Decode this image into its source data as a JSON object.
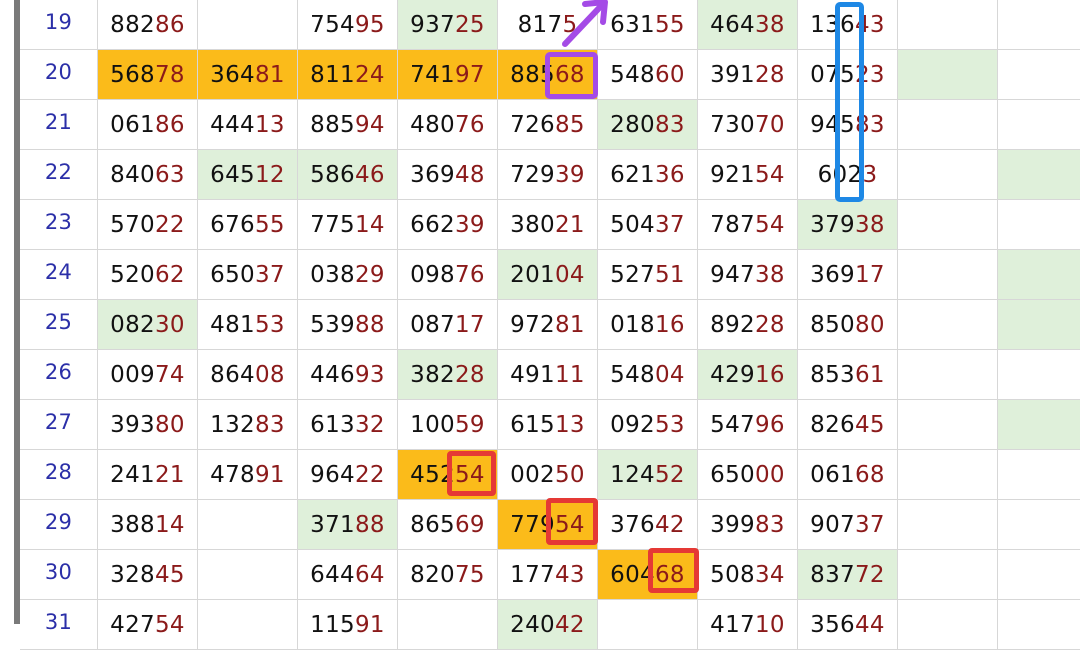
{
  "colors": {
    "green": "#dff0da",
    "orange": "#fbbb1a",
    "red_mark": "#e53935",
    "purple_mark": "#a44be6",
    "blue_mark": "#1e88e5",
    "index_text": "#2b2fa8",
    "tail_text": "#8b1a1a"
  },
  "rows": [
    {
      "idx": "19",
      "cells": [
        {
          "head": "882",
          "tail": "86",
          "bg": ""
        },
        {
          "head": "",
          "tail": "",
          "bg": ""
        },
        {
          "head": "754",
          "tail": "95",
          "bg": ""
        },
        {
          "head": "937",
          "tail": "25",
          "bg": "g"
        },
        {
          "head": "817",
          "tail": "5",
          "bg": ""
        },
        {
          "head": "631",
          "tail": "55",
          "bg": ""
        },
        {
          "head": "464",
          "tail": "38",
          "bg": "g"
        },
        {
          "head": "136",
          "tail": "43",
          "bg": ""
        },
        {
          "head": "",
          "tail": "",
          "bg": ""
        },
        {
          "head": "",
          "tail": "",
          "bg": ""
        }
      ]
    },
    {
      "idx": "20",
      "cells": [
        {
          "head": "568",
          "tail": "78",
          "bg": "o"
        },
        {
          "head": "364",
          "tail": "81",
          "bg": "o"
        },
        {
          "head": "811",
          "tail": "24",
          "bg": "o"
        },
        {
          "head": "741",
          "tail": "97",
          "bg": "o"
        },
        {
          "head": "885",
          "tail": "68",
          "bg": "o"
        },
        {
          "head": "548",
          "tail": "60",
          "bg": ""
        },
        {
          "head": "391",
          "tail": "28",
          "bg": ""
        },
        {
          "head": "075",
          "tail": "23",
          "bg": ""
        },
        {
          "head": "",
          "tail": "",
          "bg": "g"
        },
        {
          "head": "",
          "tail": "",
          "bg": ""
        }
      ]
    },
    {
      "idx": "21",
      "cells": [
        {
          "head": "061",
          "tail": "86",
          "bg": ""
        },
        {
          "head": "444",
          "tail": "13",
          "bg": ""
        },
        {
          "head": "885",
          "tail": "94",
          "bg": ""
        },
        {
          "head": "480",
          "tail": "76",
          "bg": ""
        },
        {
          "head": "726",
          "tail": "85",
          "bg": ""
        },
        {
          "head": "280",
          "tail": "83",
          "bg": "g"
        },
        {
          "head": "730",
          "tail": "70",
          "bg": ""
        },
        {
          "head": "945",
          "tail": "83",
          "bg": ""
        },
        {
          "head": "",
          "tail": "",
          "bg": ""
        },
        {
          "head": "",
          "tail": "",
          "bg": ""
        }
      ]
    },
    {
      "idx": "22",
      "cells": [
        {
          "head": "840",
          "tail": "63",
          "bg": ""
        },
        {
          "head": "645",
          "tail": "12",
          "bg": "g"
        },
        {
          "head": "586",
          "tail": "46",
          "bg": "g"
        },
        {
          "head": "369",
          "tail": "48",
          "bg": ""
        },
        {
          "head": "729",
          "tail": "39",
          "bg": ""
        },
        {
          "head": "621",
          "tail": "36",
          "bg": ""
        },
        {
          "head": "921",
          "tail": "54",
          "bg": ""
        },
        {
          "head": "602",
          "tail": "3",
          "bg": ""
        },
        {
          "head": "",
          "tail": "",
          "bg": ""
        },
        {
          "head": "",
          "tail": "",
          "bg": "g"
        }
      ]
    },
    {
      "idx": "23",
      "cells": [
        {
          "head": "570",
          "tail": "22",
          "bg": ""
        },
        {
          "head": "676",
          "tail": "55",
          "bg": ""
        },
        {
          "head": "775",
          "tail": "14",
          "bg": ""
        },
        {
          "head": "662",
          "tail": "39",
          "bg": ""
        },
        {
          "head": "380",
          "tail": "21",
          "bg": ""
        },
        {
          "head": "504",
          "tail": "37",
          "bg": ""
        },
        {
          "head": "787",
          "tail": "54",
          "bg": ""
        },
        {
          "head": "379",
          "tail": "38",
          "bg": "g"
        },
        {
          "head": "",
          "tail": "",
          "bg": ""
        },
        {
          "head": "",
          "tail": "",
          "bg": ""
        }
      ]
    },
    {
      "idx": "24",
      "cells": [
        {
          "head": "520",
          "tail": "62",
          "bg": ""
        },
        {
          "head": "650",
          "tail": "37",
          "bg": ""
        },
        {
          "head": "038",
          "tail": "29",
          "bg": ""
        },
        {
          "head": "098",
          "tail": "76",
          "bg": ""
        },
        {
          "head": "201",
          "tail": "04",
          "bg": "g"
        },
        {
          "head": "527",
          "tail": "51",
          "bg": ""
        },
        {
          "head": "947",
          "tail": "38",
          "bg": ""
        },
        {
          "head": "369",
          "tail": "17",
          "bg": ""
        },
        {
          "head": "",
          "tail": "",
          "bg": ""
        },
        {
          "head": "",
          "tail": "",
          "bg": "g"
        }
      ]
    },
    {
      "idx": "25",
      "cells": [
        {
          "head": "082",
          "tail": "30",
          "bg": "g"
        },
        {
          "head": "481",
          "tail": "53",
          "bg": ""
        },
        {
          "head": "539",
          "tail": "88",
          "bg": ""
        },
        {
          "head": "087",
          "tail": "17",
          "bg": ""
        },
        {
          "head": "972",
          "tail": "81",
          "bg": ""
        },
        {
          "head": "018",
          "tail": "16",
          "bg": ""
        },
        {
          "head": "892",
          "tail": "28",
          "bg": ""
        },
        {
          "head": "850",
          "tail": "80",
          "bg": ""
        },
        {
          "head": "",
          "tail": "",
          "bg": ""
        },
        {
          "head": "",
          "tail": "",
          "bg": "g"
        }
      ]
    },
    {
      "idx": "26",
      "cells": [
        {
          "head": "009",
          "tail": "74",
          "bg": ""
        },
        {
          "head": "864",
          "tail": "08",
          "bg": ""
        },
        {
          "head": "446",
          "tail": "93",
          "bg": ""
        },
        {
          "head": "382",
          "tail": "28",
          "bg": "g"
        },
        {
          "head": "491",
          "tail": "11",
          "bg": ""
        },
        {
          "head": "548",
          "tail": "04",
          "bg": ""
        },
        {
          "head": "429",
          "tail": "16",
          "bg": "g"
        },
        {
          "head": "853",
          "tail": "61",
          "bg": ""
        },
        {
          "head": "",
          "tail": "",
          "bg": ""
        },
        {
          "head": "",
          "tail": "",
          "bg": ""
        }
      ]
    },
    {
      "idx": "27",
      "cells": [
        {
          "head": "393",
          "tail": "80",
          "bg": ""
        },
        {
          "head": "132",
          "tail": "83",
          "bg": ""
        },
        {
          "head": "613",
          "tail": "32",
          "bg": ""
        },
        {
          "head": "100",
          "tail": "59",
          "bg": ""
        },
        {
          "head": "615",
          "tail": "13",
          "bg": ""
        },
        {
          "head": "092",
          "tail": "53",
          "bg": ""
        },
        {
          "head": "547",
          "tail": "96",
          "bg": ""
        },
        {
          "head": "826",
          "tail": "45",
          "bg": ""
        },
        {
          "head": "",
          "tail": "",
          "bg": ""
        },
        {
          "head": "",
          "tail": "",
          "bg": "g"
        }
      ]
    },
    {
      "idx": "28",
      "cells": [
        {
          "head": "241",
          "tail": "21",
          "bg": ""
        },
        {
          "head": "478",
          "tail": "91",
          "bg": ""
        },
        {
          "head": "964",
          "tail": "22",
          "bg": ""
        },
        {
          "head": "452",
          "tail": "54",
          "bg": "o"
        },
        {
          "head": "002",
          "tail": "50",
          "bg": ""
        },
        {
          "head": "124",
          "tail": "52",
          "bg": "g"
        },
        {
          "head": "650",
          "tail": "00",
          "bg": ""
        },
        {
          "head": "061",
          "tail": "68",
          "bg": ""
        },
        {
          "head": "",
          "tail": "",
          "bg": ""
        },
        {
          "head": "",
          "tail": "",
          "bg": ""
        }
      ]
    },
    {
      "idx": "29",
      "cells": [
        {
          "head": "388",
          "tail": "14",
          "bg": ""
        },
        {
          "head": "",
          "tail": "",
          "bg": ""
        },
        {
          "head": "371",
          "tail": "88",
          "bg": "g"
        },
        {
          "head": "865",
          "tail": "69",
          "bg": ""
        },
        {
          "head": "779",
          "tail": "54",
          "bg": "o"
        },
        {
          "head": "376",
          "tail": "42",
          "bg": ""
        },
        {
          "head": "399",
          "tail": "83",
          "bg": ""
        },
        {
          "head": "907",
          "tail": "37",
          "bg": ""
        },
        {
          "head": "",
          "tail": "",
          "bg": ""
        },
        {
          "head": "",
          "tail": "",
          "bg": ""
        }
      ]
    },
    {
      "idx": "30",
      "cells": [
        {
          "head": "328",
          "tail": "45",
          "bg": ""
        },
        {
          "head": "",
          "tail": "",
          "bg": ""
        },
        {
          "head": "644",
          "tail": "64",
          "bg": ""
        },
        {
          "head": "820",
          "tail": "75",
          "bg": ""
        },
        {
          "head": "177",
          "tail": "43",
          "bg": ""
        },
        {
          "head": "604",
          "tail": "68",
          "bg": "o"
        },
        {
          "head": "508",
          "tail": "34",
          "bg": ""
        },
        {
          "head": "837",
          "tail": "72",
          "bg": "g"
        },
        {
          "head": "",
          "tail": "",
          "bg": ""
        },
        {
          "head": "",
          "tail": "",
          "bg": ""
        }
      ]
    },
    {
      "idx": "31",
      "cells": [
        {
          "head": "427",
          "tail": "54",
          "bg": ""
        },
        {
          "head": "",
          "tail": "",
          "bg": ""
        },
        {
          "head": "115",
          "tail": "91",
          "bg": ""
        },
        {
          "head": "",
          "tail": "",
          "bg": ""
        },
        {
          "head": "240",
          "tail": "42",
          "bg": "g"
        },
        {
          "head": "",
          "tail": "",
          "bg": ""
        },
        {
          "head": "417",
          "tail": "10",
          "bg": ""
        },
        {
          "head": "356",
          "tail": "44",
          "bg": ""
        },
        {
          "head": "",
          "tail": "",
          "bg": ""
        },
        {
          "head": "",
          "tail": "",
          "bg": ""
        }
      ]
    }
  ]
}
